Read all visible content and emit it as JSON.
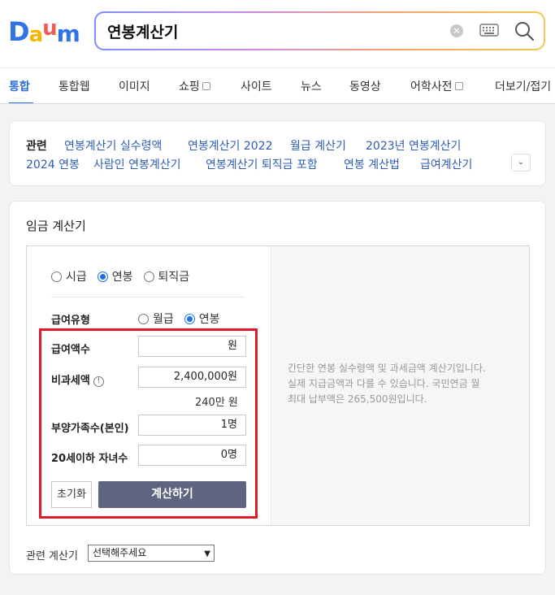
{
  "logo": {
    "letters": [
      "D",
      "a",
      "u",
      "m"
    ],
    "colors": [
      "#2E73E8",
      "#F4B400",
      "#F35B5B",
      "#2E73E8"
    ]
  },
  "search": {
    "query": "연봉계산기"
  },
  "tabs": [
    {
      "label": "통합",
      "active": true
    },
    {
      "label": "통합웹"
    },
    {
      "label": "이미지"
    },
    {
      "label": "쇼핑"
    },
    {
      "label": "사이트"
    },
    {
      "label": "뉴스"
    },
    {
      "label": "동영상"
    },
    {
      "label": "어학사전"
    },
    {
      "label": "더보기/접기"
    }
  ],
  "related": {
    "label": "관련",
    "links": [
      "연봉계산기 실수령액",
      "연봉계산기 2022",
      "월급 계산기",
      "2023년 연봉계산기",
      "2024 연봉",
      "사람인 연봉계산기",
      "연봉계산기 퇴직금 포함",
      "연봉 계산법",
      "급여계산기"
    ]
  },
  "calculator": {
    "title": "임금 계산기",
    "modes": [
      "시급",
      "연봉",
      "퇴직금"
    ],
    "mode_selected": "연봉",
    "pay_type_label": "급여유형",
    "pay_types": [
      "월급",
      "연봉"
    ],
    "pay_type_selected": "연봉",
    "salary_label": "급여액수",
    "salary_value": "원",
    "nontax_label": "비과세액",
    "nontax_value": "2,400,000원",
    "nontax_note": "240만 원",
    "dependents_label": "부양가족수(본인)",
    "dependents_value": "1명",
    "children_label": "20세이하 자녀수",
    "children_value": "0명",
    "reset_label": "초기화",
    "calculate_label": "계산하기",
    "info_lines": [
      "간단한 연봉 실수령액 및 과세금액 계산기입니다.",
      "실제 지급금액과 다를 수 있습니다. 국민연금 월",
      "최대 납부액은 265,500원입니다."
    ],
    "related_calc_label": "관련 계산기",
    "related_calc_select": "선택해주세요"
  }
}
